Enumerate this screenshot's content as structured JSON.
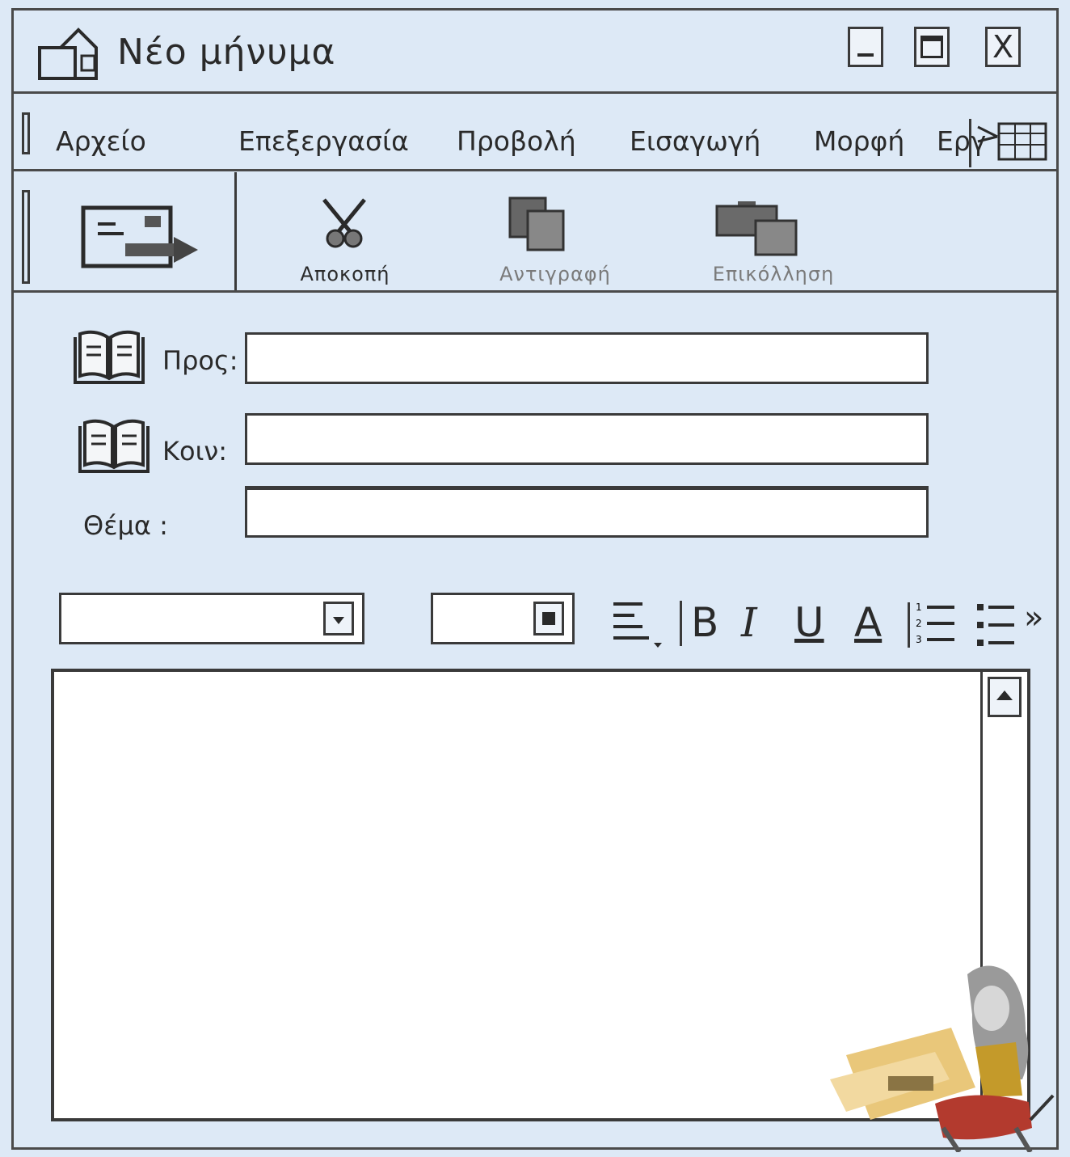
{
  "window": {
    "title": "Νέο μήνυμα",
    "controls": {
      "minimize": "minimize-icon",
      "maximize": "maximize-icon",
      "close": "X"
    }
  },
  "menu": {
    "items": [
      "Αρχείο",
      "Επεξεργασία",
      "Προβολή",
      "Εισαγωγή",
      "Μορφή",
      "Εργ"
    ],
    "overflow_icon": "chevron-right-double-icon"
  },
  "toolbar": {
    "send_icon": "send-envelope-icon",
    "cut_label": "Αποκοπή",
    "copy_label": "Αντιγραφή",
    "paste_label": "Επικόλληση"
  },
  "fields": {
    "to_label": "Προς:",
    "to_value": "",
    "cc_label": "Κοιν:",
    "cc_value": "",
    "subject_label": "Θέμα :",
    "subject_value": ""
  },
  "format": {
    "font_value": "",
    "size_value": "",
    "bold": "B",
    "italic": "I",
    "underline": "U",
    "color": "A",
    "more": "»"
  },
  "message": {
    "body": ""
  }
}
